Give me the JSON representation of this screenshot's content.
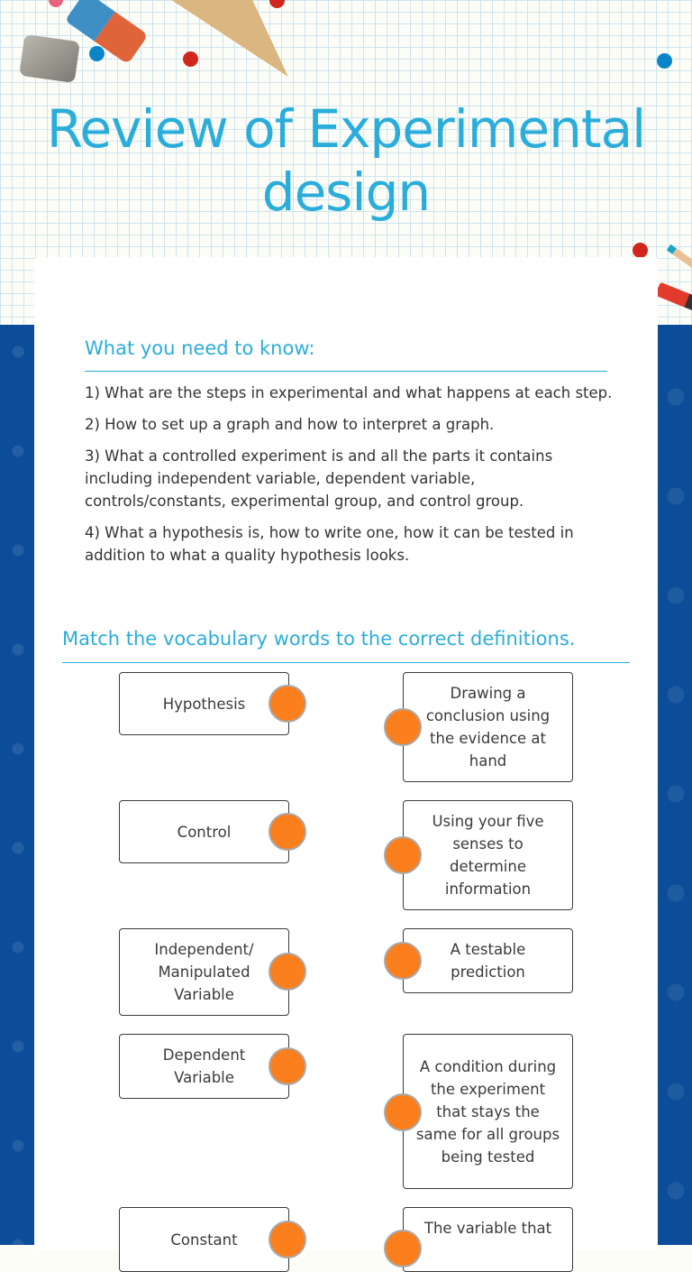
{
  "page": {
    "title": "Review of Experimental design"
  },
  "know_section": {
    "heading": "What you need to know:",
    "items": [
      "1) What are the steps in experimental and what happens at each step.",
      "2) How to set up a graph and how to interpret a graph.",
      "3) What  a controlled experiment is and all the parts it contains including independent variable, dependent variable, controls/constants, experimental group, and control group.",
      "4) What a hypothesis is, how to write one, how it can be tested in addition to what a quality hypothesis looks."
    ]
  },
  "match_section": {
    "heading": "Match the vocabulary words to the correct definitions.",
    "terms": [
      "Hypothesis",
      "Control",
      "Independent/ Manipulated Variable",
      "Dependent Variable",
      "Constant"
    ],
    "definitions": [
      "Drawing a conclusion using the evidence at hand",
      "Using your five senses to determine information",
      "A testable prediction",
      "A condition during the experiment that stays the same for all groups being tested",
      "The variable that"
    ],
    "connector_color": "#fb7f1c"
  },
  "colors": {
    "accent": "#2aaddb",
    "background_blue": "#0b4d98",
    "text": "#333333"
  }
}
